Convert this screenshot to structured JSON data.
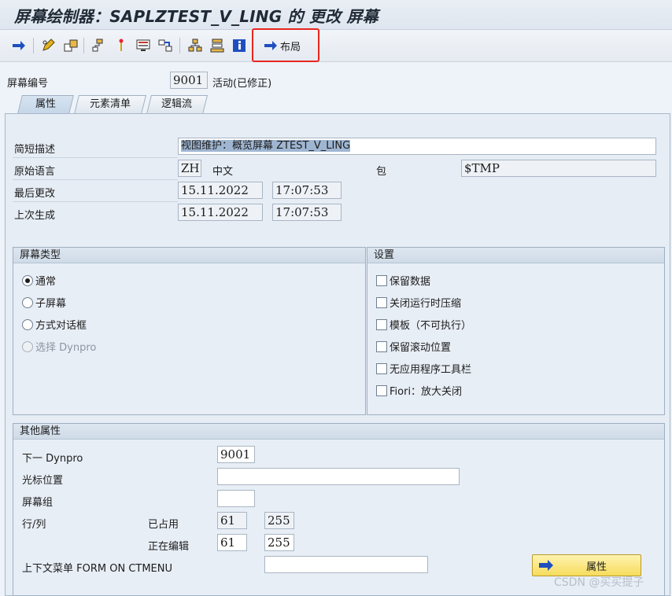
{
  "title": "屏幕绘制器：SAPLZTEST_V_LING 的 更改 屏幕",
  "toolbar": {
    "icons": [
      "arrow-right-icon",
      "pencil-glasses-icon",
      "transfer-icon",
      "hierarchy-icon",
      "pin-icon",
      "screen-icon",
      "flow-icon",
      "tree-icon",
      "stack-icon",
      "info-icon"
    ],
    "layout_label": "布局"
  },
  "header": {
    "screen_no_label": "屏幕编号",
    "screen_no": "9001",
    "status": "活动(已修正)"
  },
  "tabs": [
    {
      "label": "属性",
      "active": true
    },
    {
      "label": "元素清单",
      "active": false
    },
    {
      "label": "逻辑流",
      "active": false
    }
  ],
  "attributes": {
    "short_desc_label": "简短描述",
    "short_desc": "视图维护：概览屏幕 ZTEST_V_LING",
    "orig_lang_label": "原始语言",
    "orig_lang": "ZH",
    "orig_lang_text": "中文",
    "package_label": "包",
    "package": "$TMP",
    "last_changed_label": "最后更改",
    "last_changed_date": "15.11.2022",
    "last_changed_time": "17:07:53",
    "last_gen_label": "上次生成",
    "last_gen_date": "15.11.2022",
    "last_gen_time": "17:07:53"
  },
  "screen_type": {
    "title": "屏幕类型",
    "options": [
      {
        "label": "通常",
        "selected": true,
        "disabled": false
      },
      {
        "label": "子屏幕",
        "selected": false,
        "disabled": false
      },
      {
        "label": "方式对话框",
        "selected": false,
        "disabled": false
      },
      {
        "label": "选择 Dynpro",
        "selected": false,
        "disabled": true
      }
    ]
  },
  "settings": {
    "title": "设置",
    "options": [
      {
        "label": "保留数据",
        "checked": false
      },
      {
        "label": "关闭运行时压缩",
        "checked": false
      },
      {
        "label": "模板（不可执行）",
        "checked": false
      },
      {
        "label": "保留滚动位置",
        "checked": false
      },
      {
        "label": "无应用程序工具栏",
        "checked": false
      },
      {
        "label": "Fiori：放大关闭",
        "checked": false
      }
    ]
  },
  "other": {
    "title": "其他属性",
    "next_dynpro_label": "下一 Dynpro",
    "next_dynpro": "9001",
    "cursor_label": "光标位置",
    "cursor": "",
    "screen_group_label": "屏幕组",
    "screen_group": "",
    "rowcol_label": "行/列",
    "occupied_label": "已占用",
    "occupied_row": "61",
    "occupied_col": "255",
    "editing_label": "正在编辑",
    "editing_row": "61",
    "editing_col": "255",
    "ctx_menu_label": "上下文菜单 FORM ON CTMENU",
    "ctx_menu": "",
    "attr_button": "属性"
  },
  "watermark": "CSDN @买买提子",
  "colors": {
    "accent": "#e8271f",
    "button": "#f6dc5c",
    "nav_arrow": "#1f4fbf"
  }
}
